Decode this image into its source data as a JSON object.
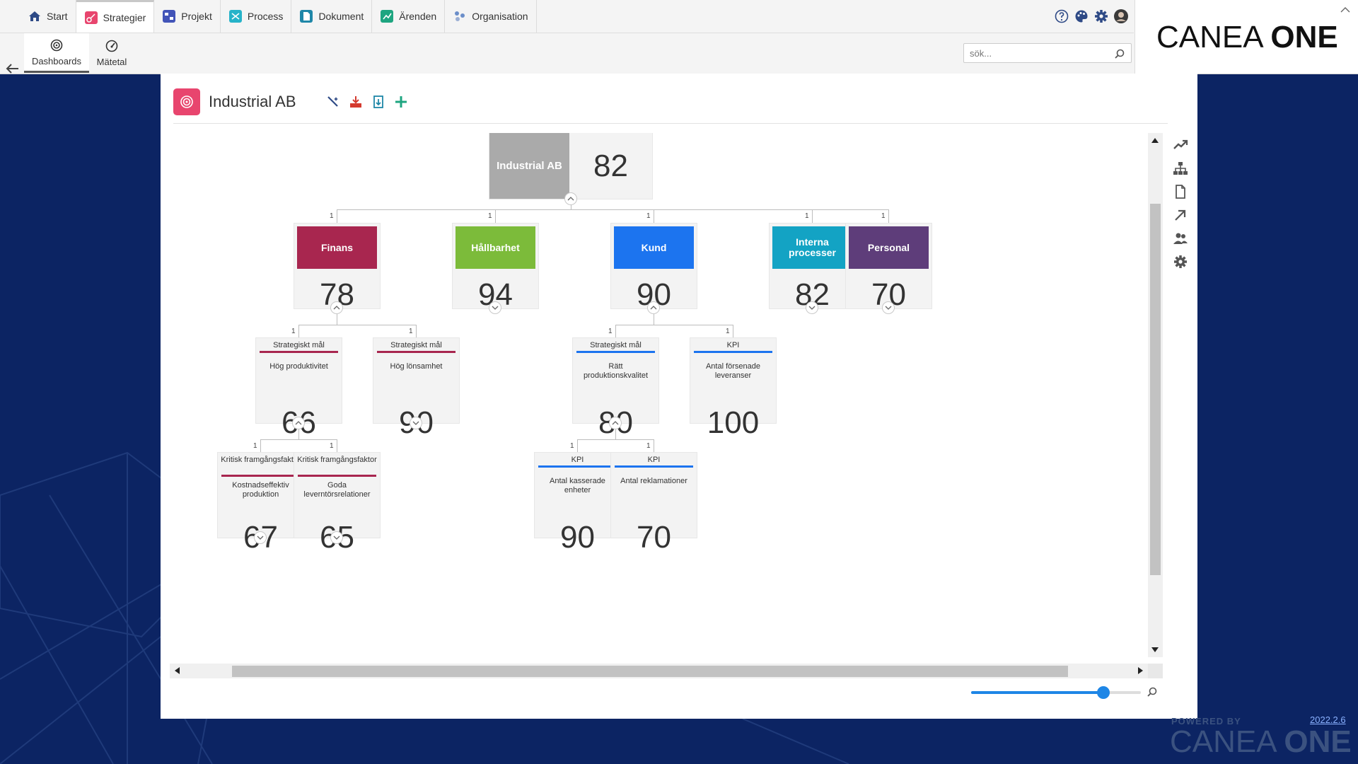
{
  "nav": {
    "tabs": [
      {
        "label": "Start",
        "icon": "home-icon"
      },
      {
        "label": "Strategier",
        "icon": "strategy-icon",
        "active": true
      },
      {
        "label": "Projekt",
        "icon": "project-icon"
      },
      {
        "label": "Process",
        "icon": "process-icon"
      },
      {
        "label": "Dokument",
        "icon": "document-icon"
      },
      {
        "label": "Ärenden",
        "icon": "cases-icon"
      },
      {
        "label": "Organisation",
        "icon": "organisation-icon"
      }
    ],
    "subtabs": [
      {
        "label": "Dashboards",
        "icon": "dashboard-icon",
        "active": true
      },
      {
        "label": "Mätetal",
        "icon": "gauge-icon"
      }
    ],
    "search_placeholder": "sök...",
    "logo_light": "CANEA ",
    "logo_bold": "ONE"
  },
  "panel": {
    "title": "Industrial AB",
    "toolbar": [
      "wand-icon",
      "download-icon",
      "export-icon",
      "add-icon"
    ]
  },
  "tree": {
    "root": {
      "label": "Industrial AB",
      "value": "82",
      "color": "#aaaaaa"
    },
    "categories": [
      {
        "label": "Finans",
        "value": "78",
        "color": "#a8264f",
        "mult": "1"
      },
      {
        "label": "Hållbarhet",
        "value": "94",
        "color": "#7cbb3a",
        "mult": "1"
      },
      {
        "label": "Kund",
        "value": "90",
        "color": "#1c74ef",
        "mult": "1"
      },
      {
        "label": "Interna processer",
        "value": "82",
        "color": "#13a3c4",
        "mult": "1"
      },
      {
        "label": "Personal",
        "value": "70",
        "color": "#5e3d7a",
        "mult": "1"
      }
    ],
    "level2": [
      {
        "type": "Strategiskt mål",
        "name": "Hög produktivitet",
        "value": "66",
        "color": "#a8264f",
        "mult": "1"
      },
      {
        "type": "Strategiskt mål",
        "name": "Hög lönsamhet",
        "value": "90",
        "color": "#a8264f",
        "mult": "1"
      },
      {
        "type": "Strategiskt mål",
        "name": "Rätt produktionskvalitet",
        "value": "80",
        "color": "#1c74ef",
        "mult": "1"
      },
      {
        "type": "KPI",
        "name": "Antal försenade leveranser",
        "value": "100",
        "color": "#1c74ef",
        "mult": "1"
      }
    ],
    "level3": [
      {
        "type": "Kritisk framgångsfaktor",
        "name": "Kostnadseffektiv produktion",
        "value": "67",
        "color": "#a8264f",
        "mult": "1"
      },
      {
        "type": "Kritisk framgångsfaktor",
        "name": "Goda leverntörsrelationer",
        "value": "65",
        "color": "#a8264f",
        "mult": "1"
      },
      {
        "type": "KPI",
        "name": "Antal kasserade enheter",
        "value": "90",
        "color": "#1c74ef",
        "mult": "1"
      },
      {
        "type": "KPI",
        "name": "Antal reklamationer",
        "value": "70",
        "color": "#1c74ef",
        "mult": "1"
      }
    ]
  },
  "zoom": {
    "level": 0.78
  },
  "footer": {
    "powered": "POWERED BY",
    "logo_light": "CANEA ",
    "logo_bold": "ONE",
    "version": "2022.2.6"
  },
  "colors": {
    "page_bg": "#0c2463",
    "accent": "#1e86e6",
    "brand_pink": "#e8456e"
  }
}
